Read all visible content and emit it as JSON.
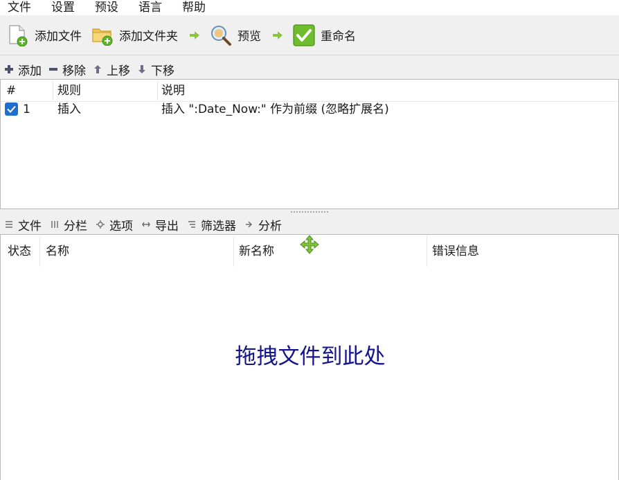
{
  "menu": [
    "文件",
    "设置",
    "预设",
    "语言",
    "帮助"
  ],
  "toolbar": {
    "add_files": "添加文件",
    "add_folder": "添加文件夹",
    "preview": "预览",
    "rename": "重命名"
  },
  "rules_toolbar": {
    "add": "添加",
    "remove": "移除",
    "move_up": "上移",
    "move_down": "下移"
  },
  "rules_table": {
    "headers": [
      "#",
      "规则",
      "说明"
    ],
    "rows": [
      {
        "checked": true,
        "index": "1",
        "rule": "插入",
        "description": "插入 \":Date_Now:\" 作为前缀 (忽略扩展名)"
      }
    ]
  },
  "files_toolbar": {
    "files": "文件",
    "columns": "分栏",
    "options": "选项",
    "export": "导出",
    "filter": "筛选器",
    "analyze": "分析"
  },
  "files_table": {
    "headers": [
      "状态",
      "名称",
      "新名称",
      "错误信息"
    ],
    "empty_hint": "拖拽文件到此处"
  },
  "colors": {
    "accent_green": "#6fbd2c",
    "checkbox_blue": "#1f6fd1",
    "drop_hint": "#14148c"
  }
}
